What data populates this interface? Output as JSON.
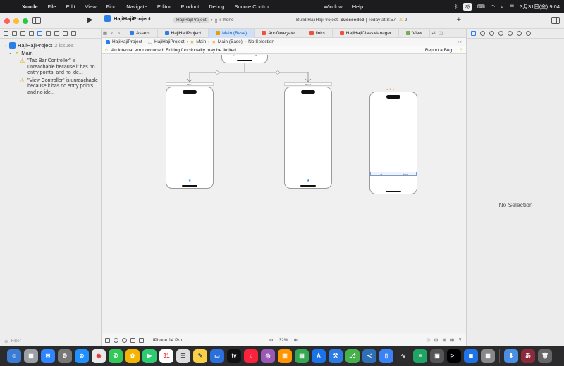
{
  "menubar": {
    "app": "Xcode",
    "items": [
      "File",
      "Edit",
      "View",
      "Find",
      "Navigate",
      "Editor",
      "Product",
      "Debug",
      "Source Control"
    ],
    "center_items": [
      "Window",
      "Help"
    ],
    "input_label": "あ",
    "clock": "3月31日(金) 9:04"
  },
  "titlebar": {
    "project": "HajiHajiProject",
    "scheme": "HajiHajiProject",
    "destination": "iPhone",
    "status_prefix": "Build HajiHajiProject:",
    "status_result": "Succeeded",
    "status_time": "| Today at 8:57",
    "warnings": "2"
  },
  "navigator": {
    "project": "HajiHajiProject",
    "project_issues": "2 issues",
    "file": "Main",
    "issues": [
      "\"Tab Bar Controller\" is unreachable because it has no entry points, and no ide...",
      "\"View Controller\" is unreachable because it has no entry points, and no ide..."
    ],
    "filter_placeholder": "Filter"
  },
  "tabs": [
    "Assets",
    "HajiHajiProject",
    "Main (Base)",
    "AppDelegate",
    "links",
    "HajiHajiClassManager",
    "View"
  ],
  "active_tab_index": 2,
  "jumpbar": [
    "HajiHajiProject",
    "HajiHajiProject",
    "Main",
    "Main (Base)",
    "No Selection"
  ],
  "error_banner": {
    "message": "An internal error occurred. Editing functionality may be limited.",
    "action": "Report a Bug"
  },
  "canvas": {
    "scene_label": "Item 1",
    "tab_item_label": "Item"
  },
  "bottom": {
    "device": "iPhone 14 Pro",
    "zoom": "32%"
  },
  "inspector": {
    "empty": "No Selection"
  },
  "colors": {
    "accent": "#2b7de9",
    "warning": "#e6a100"
  }
}
